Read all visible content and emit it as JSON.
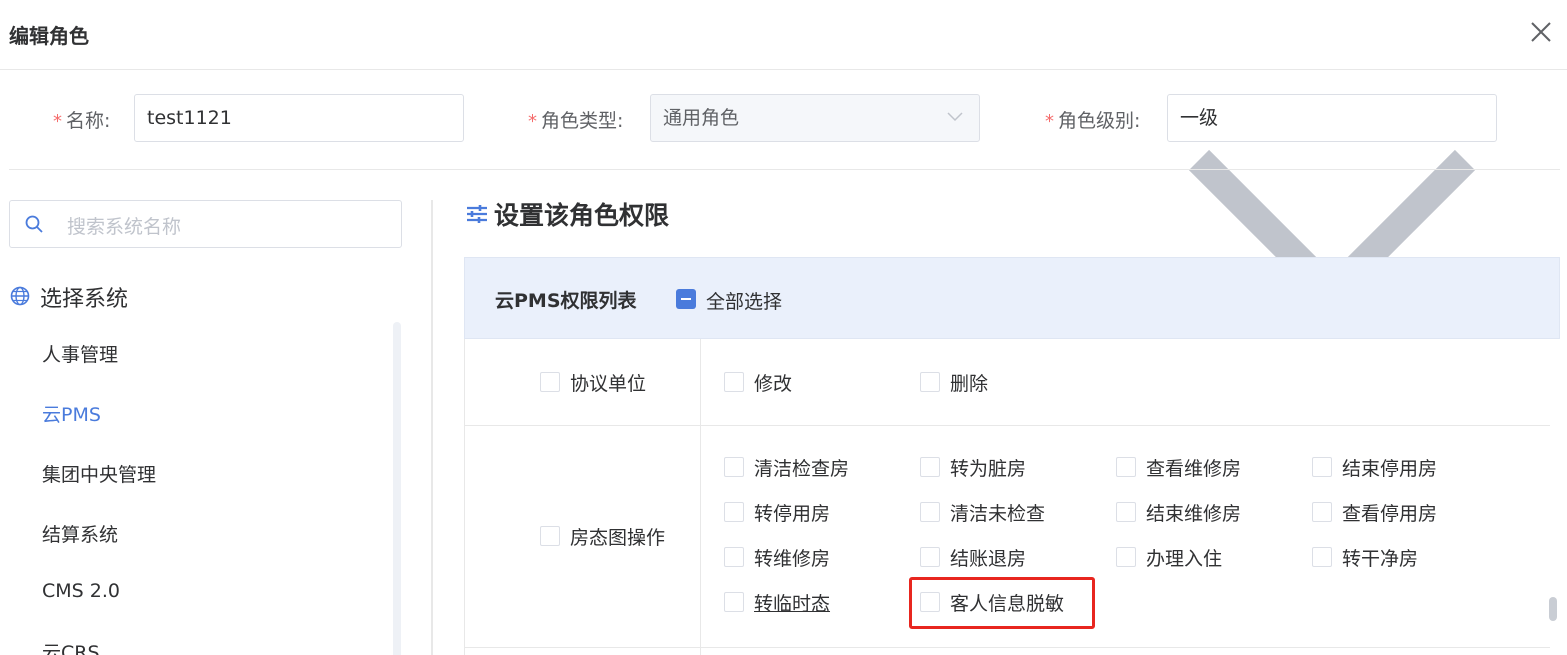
{
  "dialog": {
    "title": "编辑角色"
  },
  "form": {
    "required_mark": "*",
    "name": {
      "label": "名称:",
      "value": "test1121"
    },
    "role_type": {
      "label": "角色类型:",
      "value": "通用角色"
    },
    "role_level": {
      "label": "角色级别:",
      "value": "一级"
    }
  },
  "sidebar": {
    "search_placeholder": "搜索系统名称",
    "section_title": "选择系统",
    "items": [
      {
        "label": "人事管理"
      },
      {
        "label": "云PMS"
      },
      {
        "label": "集团中央管理"
      },
      {
        "label": "结算系统"
      },
      {
        "label": "CMS 2.0"
      },
      {
        "label": "云CRS"
      }
    ],
    "active_index": 1
  },
  "permissions": {
    "title": "设置该角色权限",
    "list_name": "云PMS权限列表",
    "select_all_label": "全部选择",
    "groups": [
      {
        "name": "协议单位",
        "items": [
          "修改",
          "删除"
        ]
      },
      {
        "name": "房态图操作",
        "items": [
          "清洁检查房",
          "转为脏房",
          "查看维修房",
          "结束停用房",
          "转停用房",
          "清洁未检查",
          "结束维修房",
          "查看停用房",
          "转维修房",
          "结账退房",
          "办理入住",
          "转干净房",
          "转临时态",
          "客人信息脱敏"
        ]
      }
    ]
  },
  "colors": {
    "accent": "#4a7bdc",
    "required": "#f56c6c",
    "highlight": "#e8261f"
  }
}
